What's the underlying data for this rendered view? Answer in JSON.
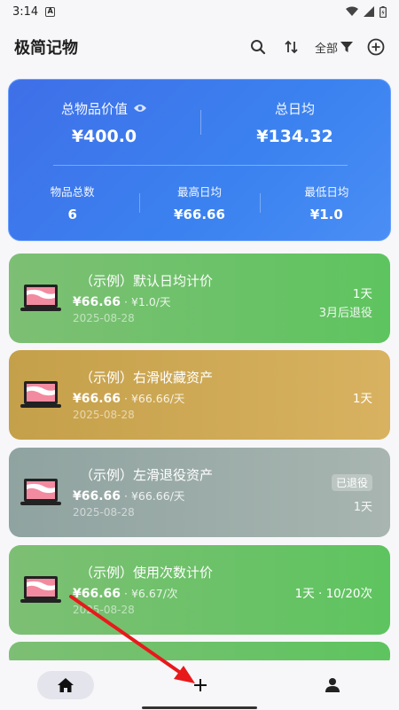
{
  "status_bar": {
    "time": "3:14",
    "a_icon": "A"
  },
  "app_bar": {
    "title": "极简记物",
    "filter_label": "全部"
  },
  "summary": {
    "total_value_label": "总物品价值",
    "total_value": "¥400.0",
    "total_daily_label": "总日均",
    "total_daily": "¥134.32",
    "count_label": "物品总数",
    "count": "6",
    "max_daily_label": "最高日均",
    "max_daily": "¥66.66",
    "min_daily_label": "最低日均",
    "min_daily": "¥1.0"
  },
  "items": [
    {
      "title": "（示例）默认日均计价",
      "price": "¥66.66",
      "daily": " · ¥1.0/天",
      "date": "2025-08-28",
      "right": "1天",
      "sub": "3月后退役",
      "badge": "",
      "color": "#6cc168"
    },
    {
      "title": "（示例）右滑收藏资产",
      "price": "¥66.66",
      "daily": " · ¥66.66/天",
      "date": "2025-08-28",
      "right": "1天",
      "sub": "",
      "badge": "",
      "color": "#cfa955"
    },
    {
      "title": "（示例）左滑退役资产",
      "price": "¥66.66",
      "daily": " · ¥66.66/天",
      "date": "2025-08-28",
      "right": "1天",
      "sub": "",
      "badge": "已退役",
      "color": "#9aaca8"
    },
    {
      "title": "（示例）使用次数计价",
      "price": "¥66.66",
      "daily": " · ¥6.67/次",
      "date": "2025-08-28",
      "right": "1天 · 10/20次",
      "sub": "",
      "badge": "",
      "color": "#6cc168"
    }
  ],
  "icons": {
    "search": "search-icon",
    "sort": "sort-icon",
    "filter": "filter-icon",
    "add": "add-circle-icon",
    "eye": "eye-icon",
    "home": "home-icon",
    "plus": "plus-icon",
    "person": "person-icon"
  },
  "colors": {
    "accent": "#3b78ef",
    "green": "#5ec45f",
    "gold": "#d0aa55",
    "gray": "#9aaca8",
    "arrow": "#e8191b"
  }
}
